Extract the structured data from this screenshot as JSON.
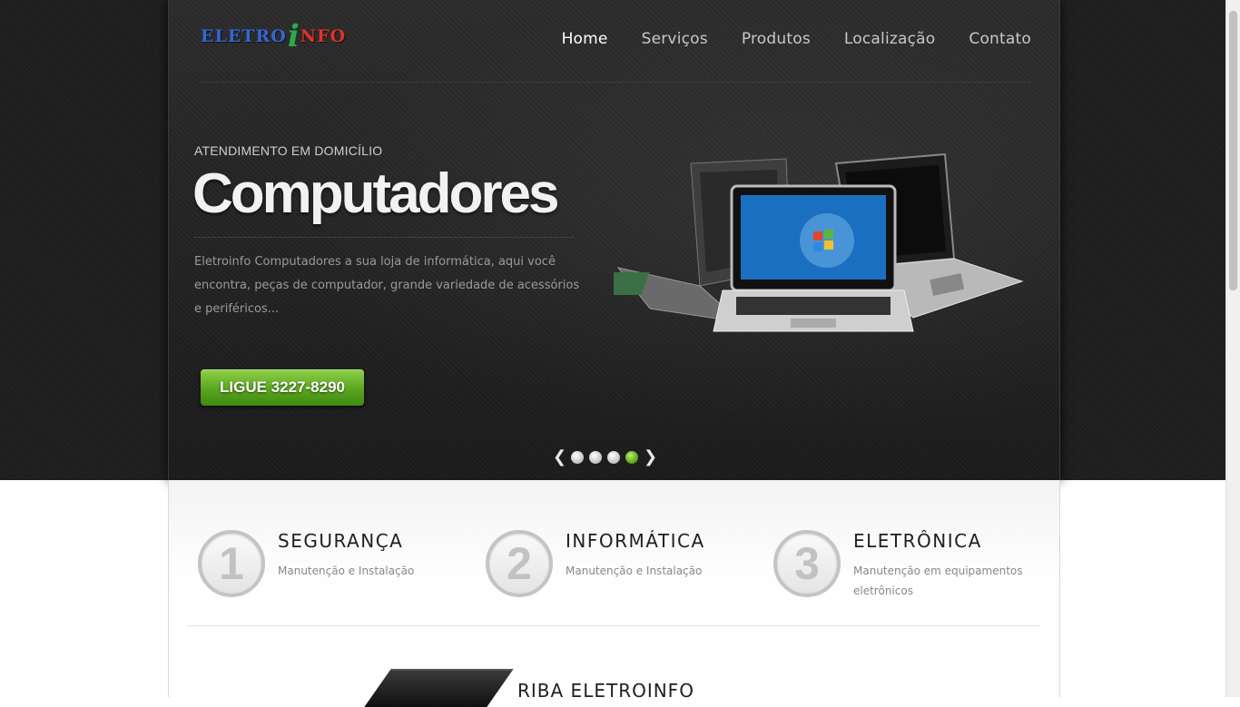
{
  "header": {
    "logo": {
      "part1": "ELETRO",
      "i": "i",
      "part2": "NFO"
    },
    "nav": [
      {
        "label": "Home",
        "active": true
      },
      {
        "label": "Serviços"
      },
      {
        "label": "Produtos"
      },
      {
        "label": "Localização"
      },
      {
        "label": "Contato"
      }
    ]
  },
  "hero": {
    "kicker": "ATENDIMENTO EM DOMICÍLIO",
    "title": "Computadores",
    "description": "Eletroinfo Computadores a sua loja de informática, aqui você encontra, peças de computador, grande variedade de acessórios e periféricos...",
    "cta_label": "LIGUE 3227-8290",
    "slider": {
      "prev": "❮",
      "next": "❯",
      "active_index": 3,
      "count": 4
    }
  },
  "features": [
    {
      "num": "1",
      "title": "SEGURANÇA",
      "subtitle": "Manutenção e Instalação"
    },
    {
      "num": "2",
      "title": "INFORMÁTICA",
      "subtitle": "Manutenção e Instalação"
    },
    {
      "num": "3",
      "title": "ELETRÔNICA",
      "subtitle": "Manutenção em equipamentos eletrônicos"
    }
  ],
  "about": {
    "title": "RIBA ELETROINFO"
  },
  "colors": {
    "accent_green": "#5aa51f",
    "dark_bg": "#1e1e1e"
  }
}
